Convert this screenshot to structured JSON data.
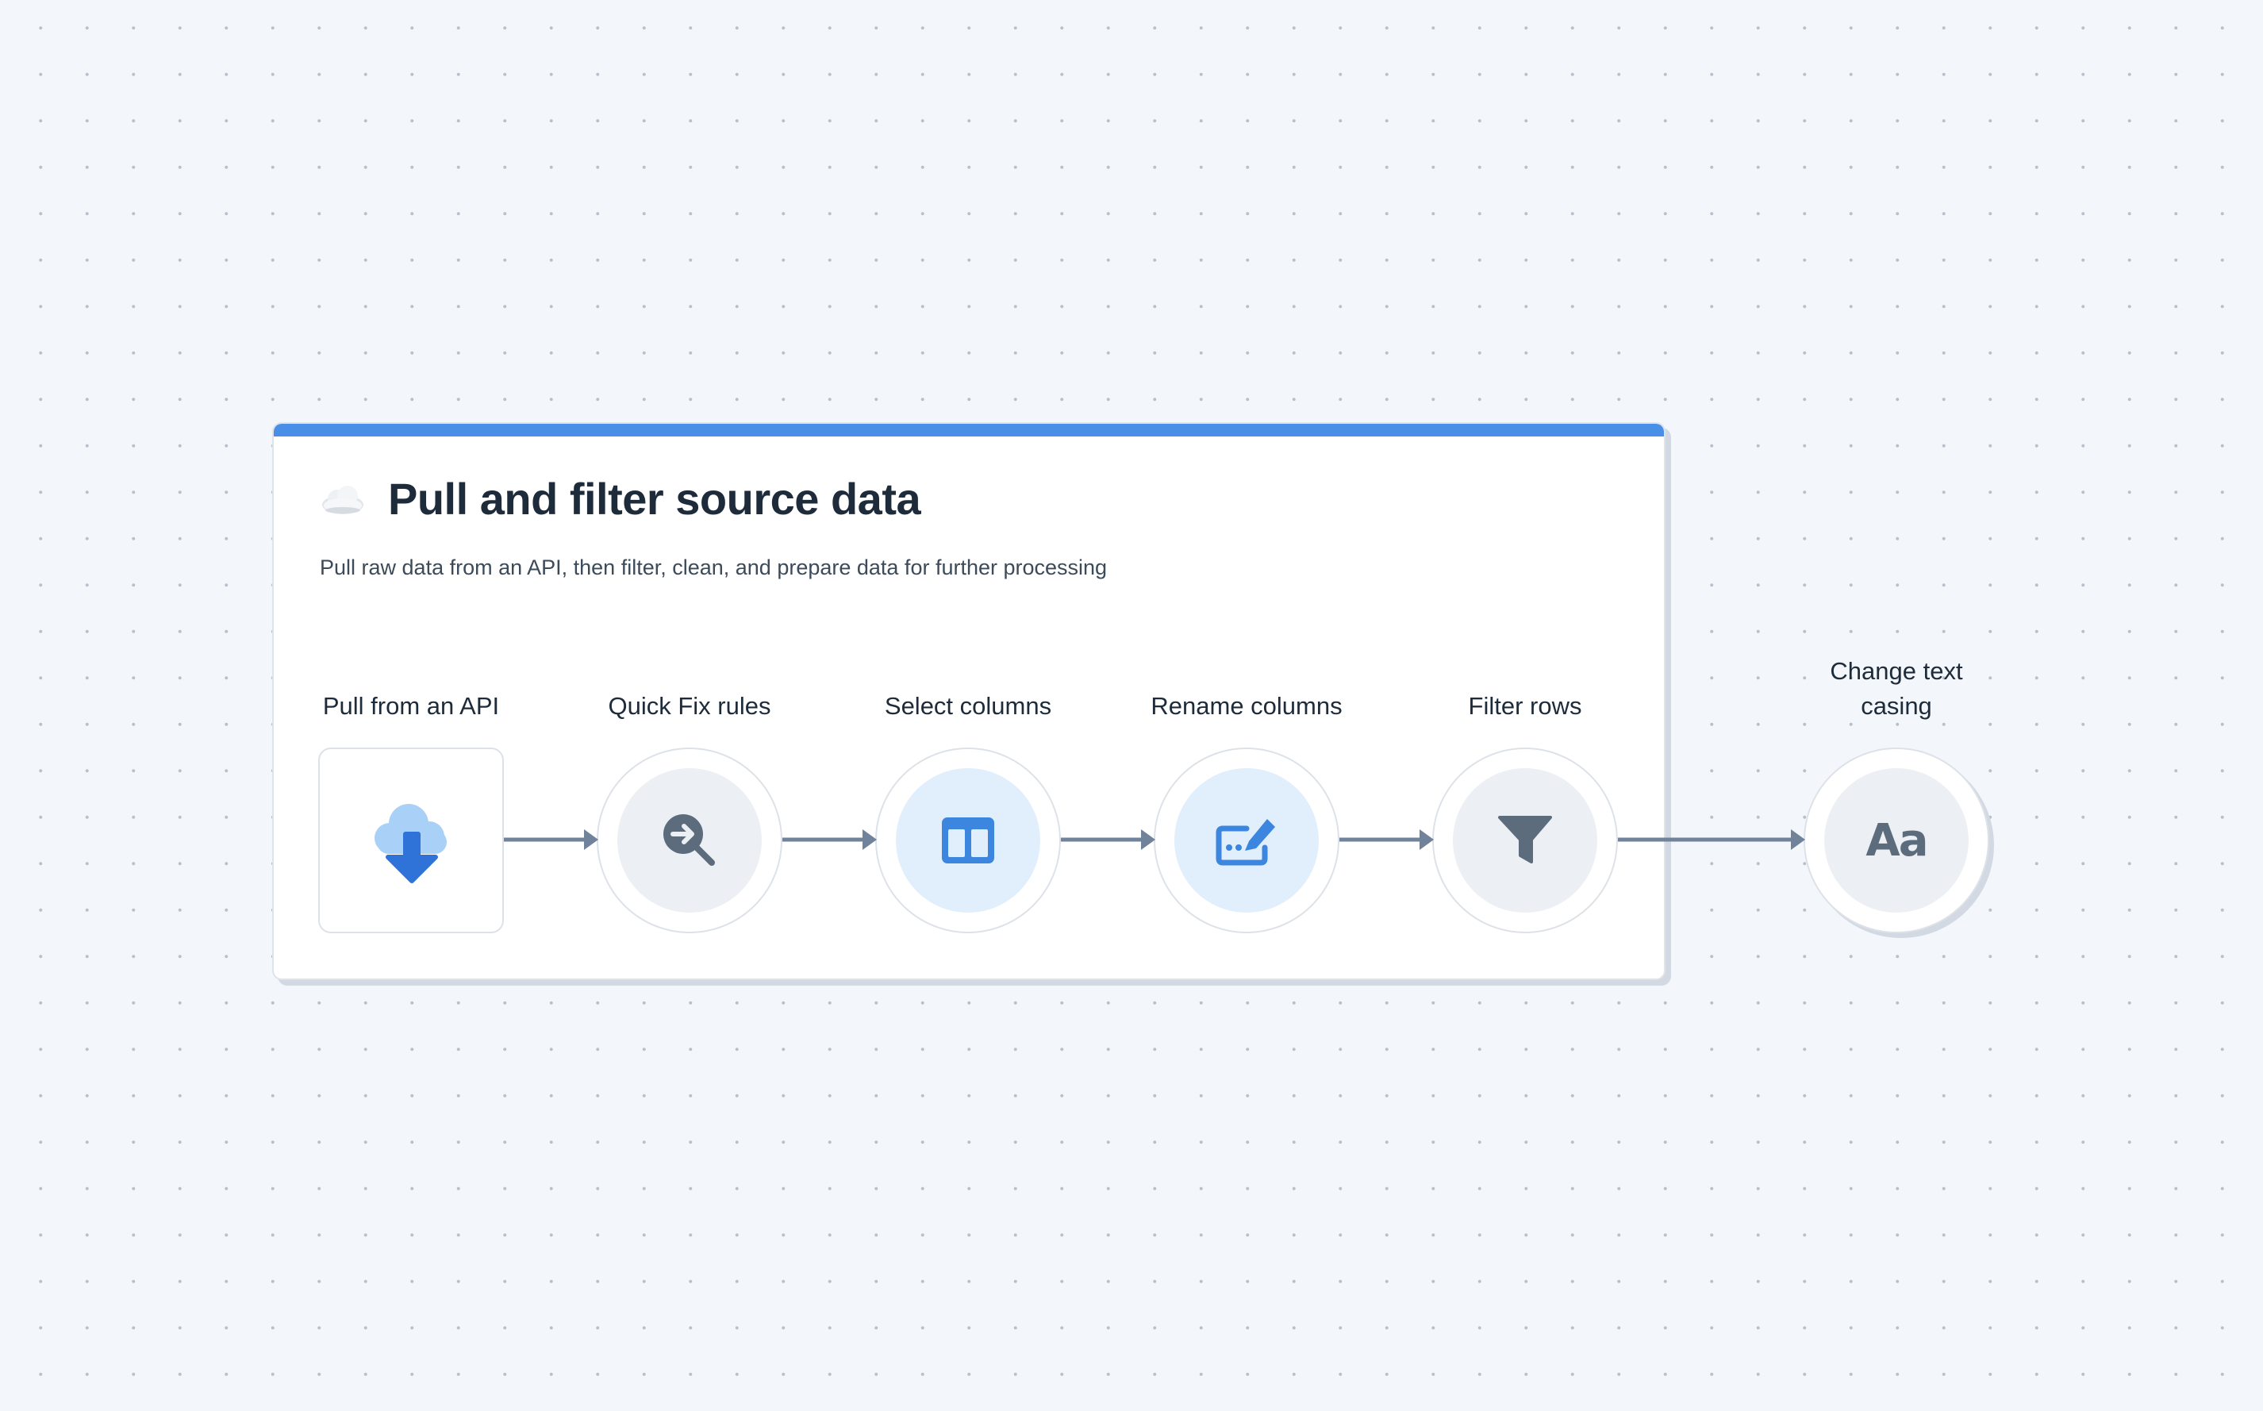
{
  "card": {
    "title": "Pull and filter source data",
    "description": "Pull raw data from an API, then filter, clean, and prepare data for further processing",
    "accent_color": "#4a8fe7",
    "title_icon": "cloud-icon"
  },
  "steps": [
    {
      "label": "Pull from an API",
      "icon": "cloud-download-icon"
    },
    {
      "label": "Quick Fix rules",
      "icon": "quick-fix-search-icon"
    },
    {
      "label": "Select columns",
      "icon": "columns-icon"
    },
    {
      "label": "Rename columns",
      "icon": "rename-edit-icon"
    },
    {
      "label": "Filter rows",
      "icon": "funnel-icon"
    },
    {
      "label_line1": "Change text",
      "label_line2": "casing",
      "icon": "text-case-icon",
      "icon_text": "Aa"
    }
  ],
  "colors": {
    "connector": "#71839a",
    "icon_blue": "#3c86e0",
    "icon_gray": "#5d6c7c",
    "node_fill_gray": "#eceff3",
    "node_fill_blue": "#e1eefb"
  }
}
